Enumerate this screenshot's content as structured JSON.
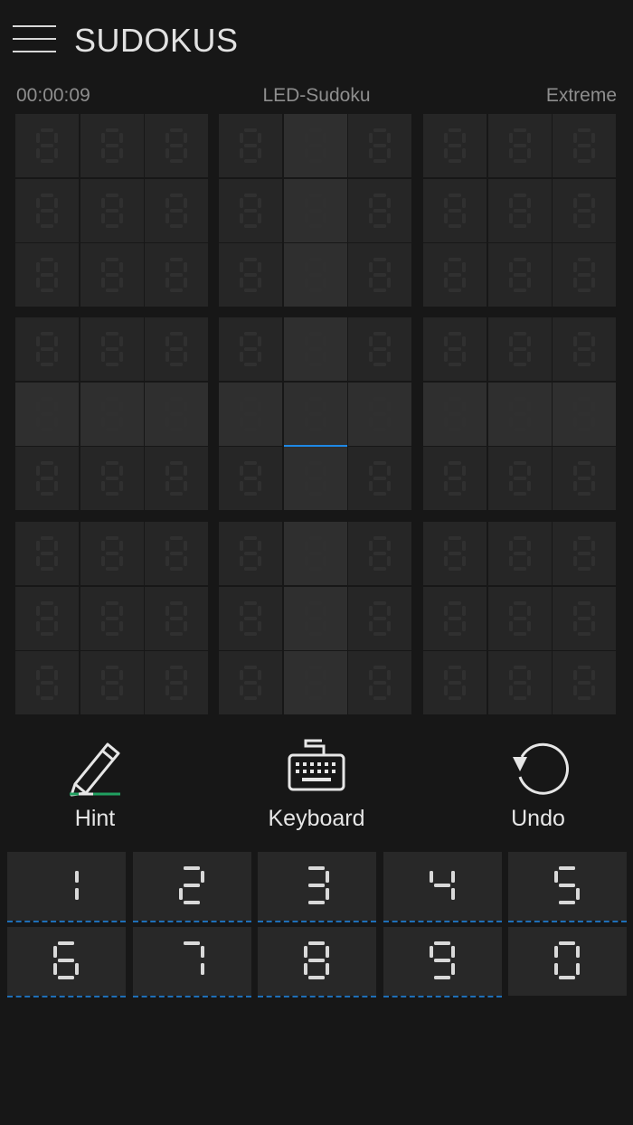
{
  "header": {
    "title": "SUDOKUS",
    "menu_icon": "hamburger-menu-icon"
  },
  "status": {
    "timer": "00:00:09",
    "mode": "LED-Sudoku",
    "difficulty": "Extreme"
  },
  "colors": {
    "digit": "#e0218a",
    "ghost": "#303030",
    "key_digit": "#d9d9d9",
    "accent": "#1e88e5"
  },
  "board": {
    "selected": [
      4,
      4
    ],
    "highlight_rows_cols": true
  },
  "tools": {
    "hint": {
      "label": "Hint",
      "icon": "pencil-icon"
    },
    "keyboard": {
      "label": "Keyboard",
      "icon": "keyboard-icon"
    },
    "undo": {
      "label": "Undo",
      "icon": "undo-icon"
    }
  },
  "keypad": {
    "keys": [
      "1",
      "2",
      "3",
      "4",
      "5",
      "6",
      "7",
      "8",
      "9",
      "0"
    ]
  }
}
